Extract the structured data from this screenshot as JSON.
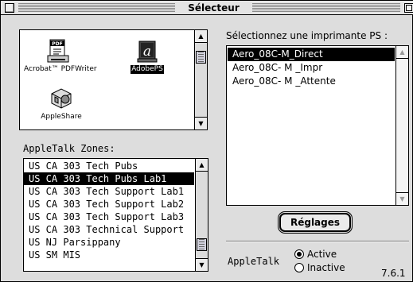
{
  "window": {
    "title": "Sélecteur"
  },
  "drivers": [
    {
      "label": "Acrobat™ PDFWriter",
      "icon": "pdf-document-icon",
      "selected": false
    },
    {
      "label": "AdobePS",
      "icon": "adobe-ps-printer-icon",
      "selected": true
    },
    {
      "label": "AppleShare",
      "icon": "appleshare-network-icon",
      "selected": false
    }
  ],
  "zones": {
    "label": "AppleTalk Zones:",
    "items": [
      "US CA 303 Tech Pubs",
      "US CA 303 Tech Pubs Lab1",
      "US CA 303 Tech Support Lab1",
      "US CA 303 Tech Support Lab2",
      "US CA 303 Tech Support Lab3",
      "US CA 303 Technical Support",
      "US NJ Parsippany",
      "US SM MIS"
    ],
    "selected_index": 1
  },
  "printers": {
    "label": "Sélectionnez une imprimante PS :",
    "items": [
      "Aero_08C-M_Direct",
      "Aero_08C- M _Impr",
      "Aero_08C- M _Attente"
    ],
    "selected_index": 0
  },
  "setup_button": {
    "label": "Réglages"
  },
  "appletalk": {
    "label": "AppleTalk",
    "active_label": "Active",
    "inactive_label": "Inactive",
    "selected": "active"
  },
  "version": "7.6.1"
}
